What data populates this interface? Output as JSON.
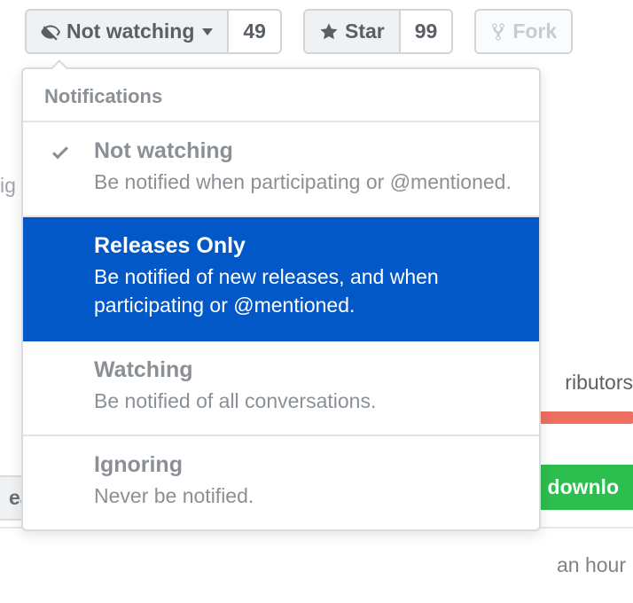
{
  "toolbar": {
    "watch": {
      "label": "Not watching",
      "count": "49"
    },
    "star": {
      "label": "Star",
      "count": "99"
    },
    "fork": {
      "label": "Fork"
    }
  },
  "dropdown": {
    "header": "Notifications",
    "items": [
      {
        "title": "Not watching",
        "desc": "Be notified when participating or @mentioned.",
        "checked": true,
        "selected": false
      },
      {
        "title": "Releases Only",
        "desc": "Be notified of new releases, and when participating or @mentioned.",
        "checked": false,
        "selected": true
      },
      {
        "title": "Watching",
        "desc": "Be notified of all conversations.",
        "checked": false,
        "selected": false
      },
      {
        "title": "Ignoring",
        "desc": "Never be notified.",
        "checked": false,
        "selected": false
      }
    ]
  },
  "background": {
    "frag_left": "ig",
    "frag_contrib": "ributors",
    "frag_download": "downlo",
    "frag_create": "ea",
    "frag_time": "an hour"
  }
}
